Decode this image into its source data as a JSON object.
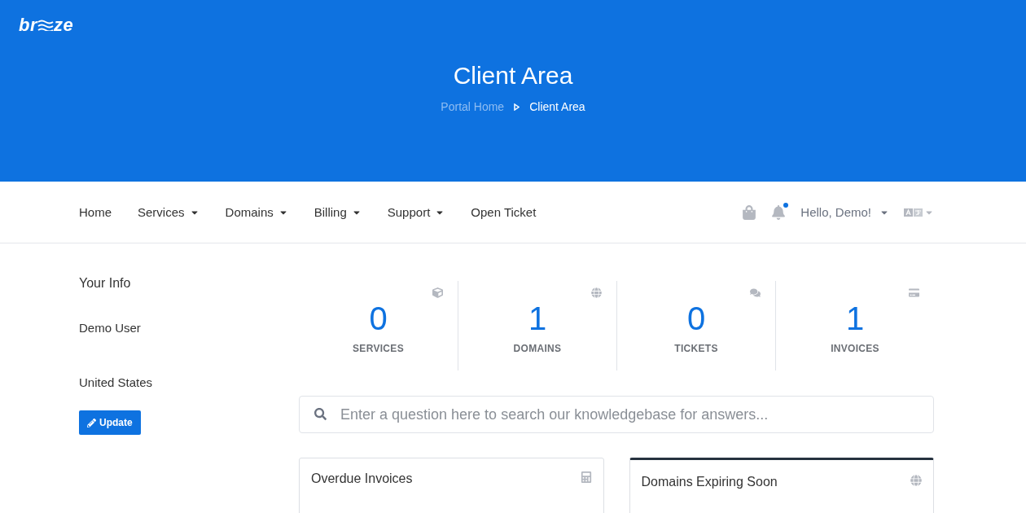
{
  "logo": {
    "before": "br",
    "after": "ze"
  },
  "header": {
    "title": "Client Area",
    "breadcrumb": [
      {
        "label": "Portal Home",
        "current": false
      },
      {
        "label": "Client Area",
        "current": true
      }
    ]
  },
  "nav": {
    "items": [
      {
        "label": "Home",
        "has_menu": false
      },
      {
        "label": "Services",
        "has_menu": true
      },
      {
        "label": "Domains",
        "has_menu": true
      },
      {
        "label": "Billing",
        "has_menu": true
      },
      {
        "label": "Support",
        "has_menu": true
      },
      {
        "label": "Open Ticket",
        "has_menu": false
      }
    ],
    "notifications_unread": true,
    "user": "Hello, Demo!"
  },
  "info": {
    "title": "Your Info",
    "lines": [
      "Demo User",
      "United States"
    ],
    "button": "Update"
  },
  "stats": [
    {
      "kind": "services",
      "value": "0",
      "label": "SERVICES"
    },
    {
      "kind": "domains",
      "value": "1",
      "label": "DOMAINS"
    },
    {
      "kind": "tickets",
      "value": "0",
      "label": "TICKETS"
    },
    {
      "kind": "invoices",
      "value": "1",
      "label": "INVOICES"
    }
  ],
  "search": {
    "placeholder": "Enter a question here to search our knowledgebase for answers..."
  },
  "panels": [
    {
      "kind": "invoices",
      "title": "Overdue Invoices",
      "accent": false
    },
    {
      "kind": "domains",
      "title": "Domains Expiring Soon",
      "accent": true
    }
  ]
}
